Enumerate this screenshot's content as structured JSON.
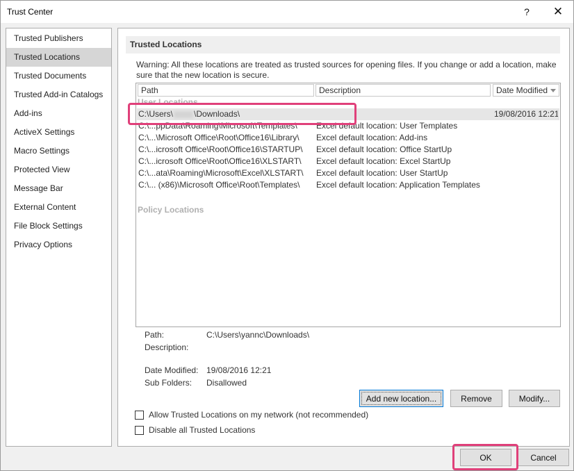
{
  "window": {
    "title": "Trust Center",
    "help_label": "?",
    "close_label": "✕"
  },
  "sidebar": {
    "items": [
      {
        "label": "Trusted Publishers"
      },
      {
        "label": "Trusted Locations",
        "selected": true
      },
      {
        "label": "Trusted Documents"
      },
      {
        "label": "Trusted Add-in Catalogs"
      },
      {
        "label": "Add-ins"
      },
      {
        "label": "ActiveX Settings"
      },
      {
        "label": "Macro Settings"
      },
      {
        "label": "Protected View"
      },
      {
        "label": "Message Bar"
      },
      {
        "label": "External Content"
      },
      {
        "label": "File Block Settings"
      },
      {
        "label": "Privacy Options"
      }
    ]
  },
  "main": {
    "section_title": "Trusted Locations",
    "warning_text": "Warning: All these locations are treated as trusted sources for opening files.  If you change or add a location, make sure that the new location is secure.",
    "columns": {
      "path": "Path",
      "description": "Description",
      "date_modified": "Date Modified"
    },
    "user_group_label": "User Locations",
    "user_locations": [
      {
        "path_prefix": "C:\\Users\\",
        "path_suffix": "\\Downloads\\",
        "description": "",
        "date": "19/08/2016 12:21",
        "selected": true
      },
      {
        "path": "C:\\...ppData\\Roaming\\Microsoft\\Templates\\",
        "description": "Excel default location: User Templates",
        "date": ""
      },
      {
        "path": "C:\\...\\Microsoft Office\\Root\\Office16\\Library\\",
        "description": "Excel default location: Add-ins",
        "date": ""
      },
      {
        "path": "C:\\...icrosoft Office\\Root\\Office16\\STARTUP\\",
        "description": "Excel default location: Office StartUp",
        "date": ""
      },
      {
        "path": "C:\\...icrosoft Office\\Root\\Office16\\XLSTART\\",
        "description": "Excel default location: Excel StartUp",
        "date": ""
      },
      {
        "path": "C:\\...ata\\Roaming\\Microsoft\\Excel\\XLSTART\\",
        "description": "Excel default location: User StartUp",
        "date": ""
      },
      {
        "path": "C:\\... (x86)\\Microsoft Office\\Root\\Templates\\",
        "description": "Excel default location: Application Templates",
        "date": ""
      }
    ],
    "policy_group_label": "Policy Locations",
    "details": {
      "path_label": "Path:",
      "path_value": "C:\\Users\\yannc\\Downloads\\",
      "description_label": "Description:",
      "description_value": "",
      "date_label": "Date Modified:",
      "date_value": "19/08/2016 12:21",
      "subfolders_label": "Sub Folders:",
      "subfolders_value": "Disallowed"
    },
    "buttons": {
      "add": "Add new location...",
      "remove": "Remove",
      "modify": "Modify..."
    },
    "checkboxes": {
      "allow_network": "Allow Trusted Locations on my network (not recommended)",
      "disable_all": "Disable all Trusted Locations"
    }
  },
  "footer": {
    "ok": "OK",
    "cancel": "Cancel"
  },
  "colors": {
    "highlight": "#e0407a",
    "selected_row": "#e6e6e6",
    "sidebar_selected": "#d6d6d6"
  }
}
